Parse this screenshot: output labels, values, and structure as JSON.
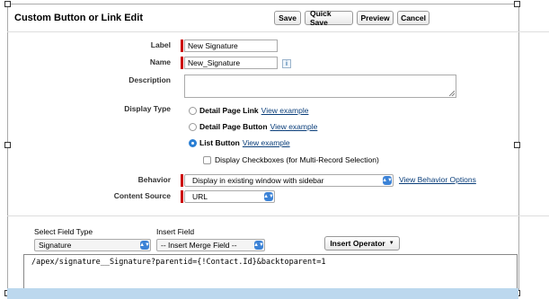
{
  "header": {
    "title": "Custom Button or Link Edit",
    "buttons": {
      "save": "Save",
      "quick_save": "Quick Save",
      "preview": "Preview",
      "cancel": "Cancel"
    }
  },
  "fields": {
    "label": {
      "label": "Label",
      "value": "New Signature"
    },
    "name": {
      "label": "Name",
      "value": "New_Signature",
      "info_icon": "i"
    },
    "description": {
      "label": "Description",
      "value": ""
    },
    "display_type": {
      "label": "Display Type",
      "options": [
        {
          "label": "Detail Page Link",
          "link": "View example",
          "selected": false
        },
        {
          "label": "Detail Page Button",
          "link": "View example",
          "selected": false
        },
        {
          "label": "List Button",
          "link": "View example",
          "selected": true
        }
      ],
      "checkbox_label": "Display Checkboxes (for Multi-Record Selection)"
    },
    "behavior": {
      "label": "Behavior",
      "value": "Display in existing window with sidebar",
      "link": "View Behavior Options"
    },
    "content_source": {
      "label": "Content Source",
      "value": "URL"
    }
  },
  "formula": {
    "select_field_type_label": "Select Field Type",
    "select_field_type_value": "Signature",
    "insert_field_label": "Insert Field",
    "insert_field_value": "-- Insert Merge Field --",
    "insert_operator": "Insert Operator",
    "code": "/apex/signature__Signature?parentid={!Contact.Id}&backtoparent=1"
  },
  "colors": {
    "required": "#cc0000",
    "link": "#0a3e7a",
    "select_chevron": "#3b82d6",
    "bottom_strip": "#bcd8ee"
  }
}
